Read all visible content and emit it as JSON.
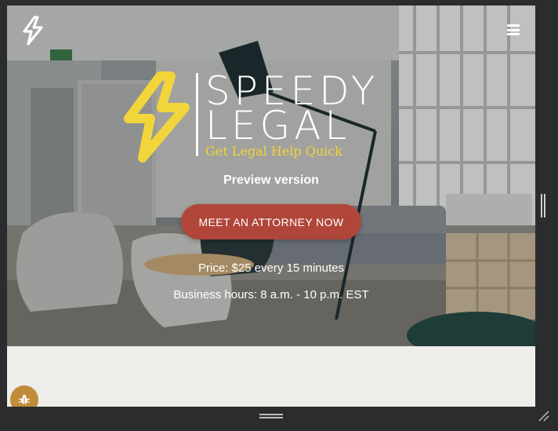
{
  "brand": {
    "icon": "lightning-bolt-icon",
    "logo_word_1": "SPEEDY",
    "logo_word_2": "LEGAL",
    "tagline": "Get Legal Help Quick",
    "accent_color": "#f2d43b"
  },
  "header": {
    "menu_icon": "hamburger-menu-icon"
  },
  "hero": {
    "preview_label": "Preview version",
    "cta_label": "MEET AN ATTORNEY NOW",
    "cta_color": "#b0463a",
    "price_prefix": "Price:",
    "price_amount": "$25",
    "price_every": "every",
    "price_interval": "15 minutes",
    "hours_text": "Business hours: 8 a.m. - 10 p.m. EST"
  },
  "widgets": {
    "bug_icon": "bug-icon",
    "bug_color": "#c28b3a"
  }
}
